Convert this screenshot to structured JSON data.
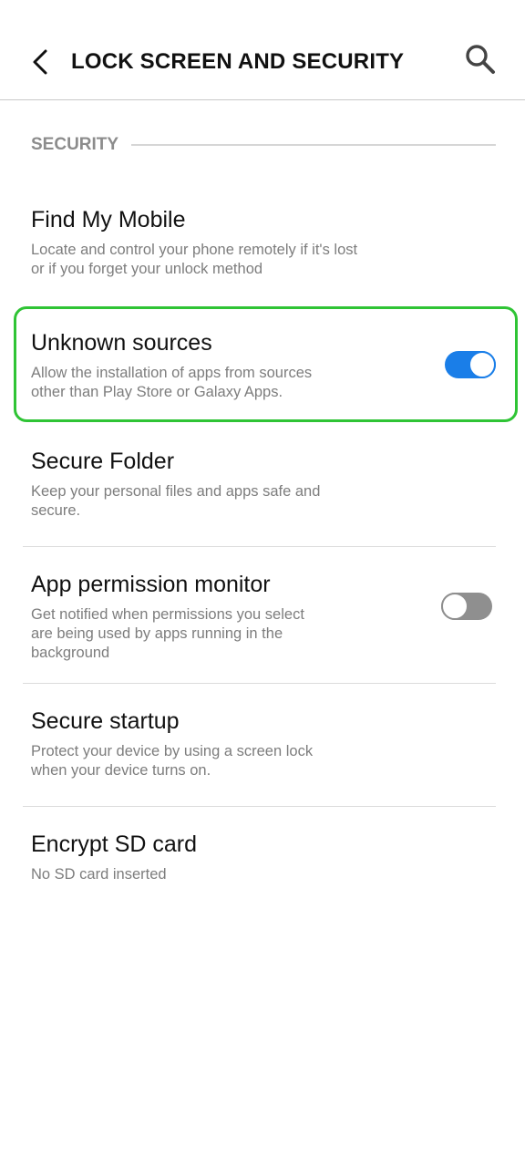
{
  "header": {
    "title": "LOCK SCREEN AND SECURITY",
    "back_icon": "chevron-left-icon",
    "search_icon": "search-icon"
  },
  "section": {
    "label": "SECURITY"
  },
  "settings": [
    {
      "title": "Find My Mobile",
      "subtitle_lines": [
        "Locate and control your phone remotely if it's lost",
        "or if you forget your unlock method"
      ]
    },
    {
      "title": "Unknown sources",
      "subtitle_lines": [
        "Allow the installation of apps from sources",
        "other than Play Store or Galaxy Apps."
      ],
      "toggle_state": "on"
    },
    {
      "title": "Secure Folder",
      "subtitle_lines": [
        "Keep your personal files and apps safe and",
        "secure."
      ]
    },
    {
      "title": "App permission monitor",
      "subtitle_lines": [
        "Get notified when permissions you select",
        "are being used by apps running in the",
        "background"
      ],
      "toggle_state": "off"
    },
    {
      "title": "Secure startup",
      "subtitle_lines": [
        "Protect your device by using a screen lock",
        "when your device turns on."
      ]
    },
    {
      "title": "Encrypt SD card",
      "subtitle_lines": [
        "No SD card inserted"
      ]
    }
  ],
  "colors": {
    "accent": "#1a7ee8",
    "highlight": "#2fc435",
    "toggle_off": "#8f8f8f",
    "subtitle": "#7d7d7d",
    "section_label": "#8c8c8c"
  }
}
